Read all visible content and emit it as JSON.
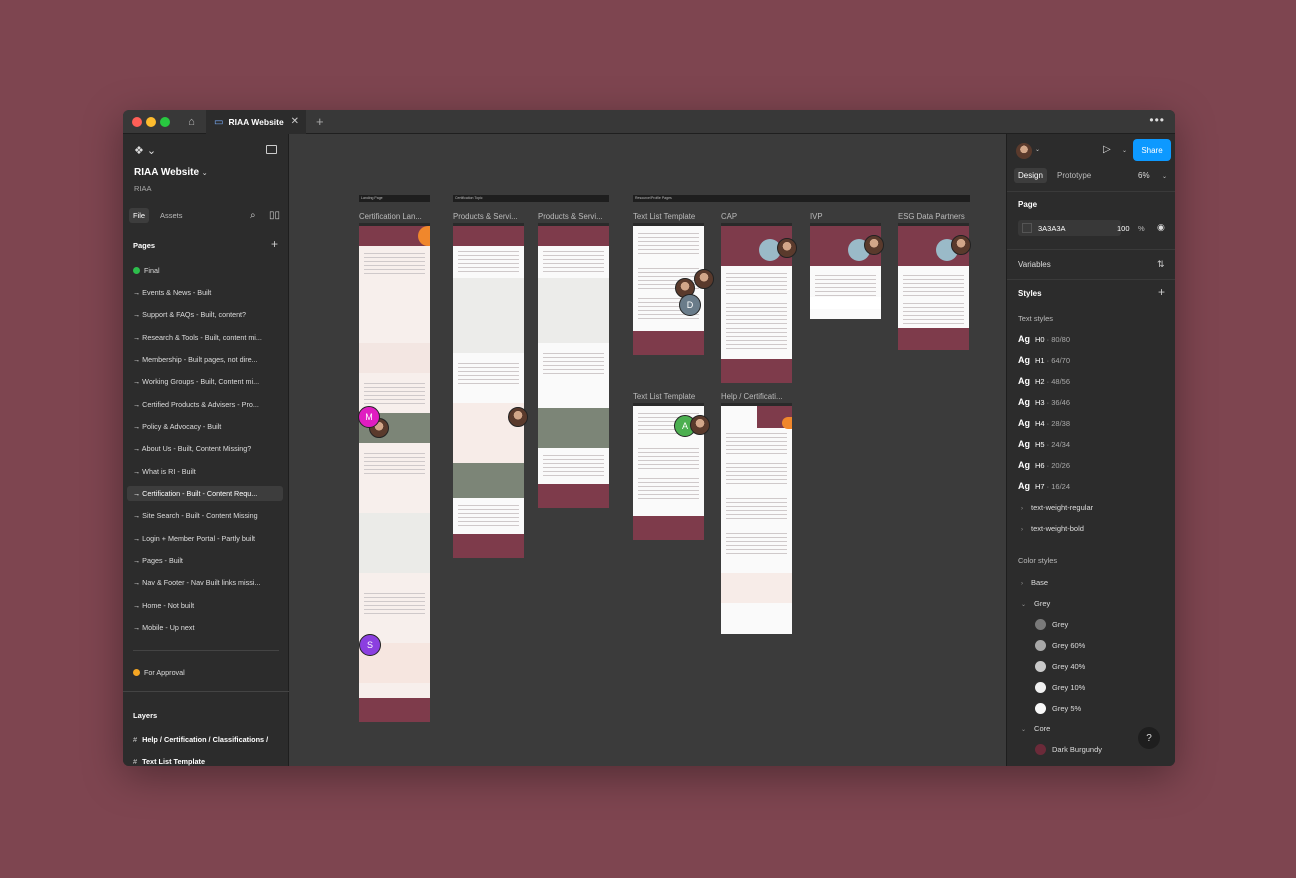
{
  "window": {
    "tab_title": "RIAA Website",
    "more_label": "•••",
    "traffic_colors": [
      "#FF5F57",
      "#FEBC2E",
      "#28C840"
    ]
  },
  "left_panel": {
    "project_title": "RIAA Website",
    "project_subtitle": "RIAA",
    "tabs": {
      "file": "File",
      "assets": "Assets"
    },
    "pages_header": "Pages",
    "pages": [
      "Final",
      "→ Events & News - Built",
      "→ Support & FAQs - Built, content?",
      "→ Research & Tools - Built, content mi...",
      "→ Membership - Built pages, not dire...",
      "→ Working Groups - Built, Content mi...",
      "→ Certified Products & Advisers - Pro...",
      "→ Policy & Advocacy - Built",
      "→ About Us - Built, Content Missing?",
      "→ What is RI - Built",
      "→ Certification - Built - Content Requ...",
      "→ Site Search - Built - Content Missing",
      "→ Login + Member Portal - Partly built",
      "→ Pages - Built",
      "→ Nav & Footer - Nav Built links missi...",
      "→ Home - Not built",
      "→ Mobile - Up next"
    ],
    "for_approval": "For Approval",
    "layers_header": "Layers",
    "layers": [
      "Help / Certification / Classifications /",
      "Text List Template"
    ]
  },
  "canvas": {
    "section_labels": [
      "Landing Page",
      "Certification Topic",
      "Resource/Profile Pages"
    ],
    "frames": [
      "Certification Lan...",
      "Products & Servi...",
      "Products & Servi...",
      "Text List Template",
      "CAP",
      "IVP",
      "ESG Data Partners",
      "Text List Template",
      "Help / Certificati..."
    ],
    "cursors": [
      {
        "letter": "M",
        "color": "#E01DC1"
      },
      {
        "letter": "D",
        "color": "#6A7C8A"
      },
      {
        "letter": "A",
        "color": "#4CAF50"
      },
      {
        "letter": "S",
        "color": "#8B3FE0"
      }
    ]
  },
  "toolbar": {
    "tools": [
      "move-tool",
      "frame-tool",
      "shape-tool",
      "pen-tool",
      "text-tool",
      "comment-tool",
      "actions-tool"
    ],
    "modes": [
      "draw-mode",
      "design-mode",
      "dev-mode"
    ]
  },
  "right_panel": {
    "share_label": "Share",
    "tabs": {
      "design": "Design",
      "prototype": "Prototype"
    },
    "zoom": "6%",
    "page_header": "Page",
    "page_color": "3A3A3A",
    "page_opacity": "100",
    "page_opacity_unit": "%",
    "variables_label": "Variables",
    "styles_header": "Styles",
    "text_styles_header": "Text styles",
    "text_styles": [
      {
        "ag": "Ag",
        "name": "H0",
        "meta": " · 80/80"
      },
      {
        "ag": "Ag",
        "name": "H1",
        "meta": " · 64/70"
      },
      {
        "ag": "Ag",
        "name": "H2",
        "meta": " · 48/56"
      },
      {
        "ag": "Ag",
        "name": "H3",
        "meta": " · 36/46"
      },
      {
        "ag": "Ag",
        "name": "H4",
        "meta": " · 28/38"
      },
      {
        "ag": "Ag",
        "name": "H5",
        "meta": " · 24/34"
      },
      {
        "ag": "Ag",
        "name": "H6",
        "meta": " · 20/26"
      },
      {
        "ag": "Ag",
        "name": "H7",
        "meta": " · 16/24"
      }
    ],
    "text_groups": [
      "text-weight-regular",
      "text-weight-bold"
    ],
    "color_styles_header": "Color styles",
    "color_groups": {
      "base": "Base",
      "grey": "Grey",
      "core": "Core"
    },
    "grey_colors": [
      {
        "name": "Grey",
        "hex": "#7A7A7A"
      },
      {
        "name": "Grey 60%",
        "hex": "#A8A8A8"
      },
      {
        "name": "Grey 40%",
        "hex": "#C9C9C9"
      },
      {
        "name": "Grey 10%",
        "hex": "#F0F0F0"
      },
      {
        "name": "Grey 5%",
        "hex": "#F8F8F8"
      }
    ],
    "core_colors": [
      {
        "name": "Dark Burgundy",
        "hex": "#6B2A39"
      }
    ],
    "help_label": "?"
  }
}
